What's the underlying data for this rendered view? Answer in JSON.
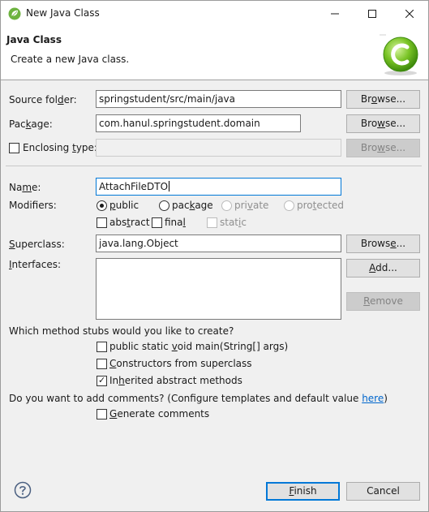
{
  "window": {
    "title": "New Java Class"
  },
  "banner": {
    "title": "Java Class",
    "message": "Create a new Java class."
  },
  "source_folder": {
    "label_pre": "Source fol",
    "label_ul": "d",
    "label_post": "er:",
    "value": "springstudent/src/main/java",
    "browse_pre": "Br",
    "browse_ul": "o",
    "browse_post": "wse..."
  },
  "package": {
    "label_pre": "Pac",
    "label_ul": "k",
    "label_post": "age:",
    "value": "com.hanul.springstudent.domain",
    "browse_pre": "Bro",
    "browse_ul": "w",
    "browse_post": "se..."
  },
  "enclosing_type": {
    "checked": false,
    "label_pre": "Enclosing ",
    "label_ul": "t",
    "label_post": "ype:",
    "value": "",
    "browse_pre": "Bro",
    "browse_ul": "w",
    "browse_post": "se..."
  },
  "name": {
    "label_pre": "Na",
    "label_ul": "m",
    "label_post": "e:",
    "value": "AttachFileDTO"
  },
  "modifiers": {
    "label": "Modifiers:",
    "public": {
      "pre": "",
      "ul": "p",
      "post": "ublic",
      "selected": true
    },
    "package": {
      "pre": "pac",
      "ul": "k",
      "post": "age",
      "selected": false
    },
    "private": {
      "pre": "pri",
      "ul": "v",
      "post": "ate",
      "selected": false
    },
    "protected": {
      "pre": "pro",
      "ul": "t",
      "post": "ected",
      "selected": false
    },
    "abstract": {
      "pre": "abs",
      "ul": "t",
      "post": "ract",
      "checked": false
    },
    "final": {
      "pre": "fina",
      "ul": "l",
      "post": "",
      "checked": false
    },
    "static": {
      "pre": "stat",
      "ul": "i",
      "post": "c",
      "checked": false
    }
  },
  "superclass": {
    "label_pre": "",
    "label_ul": "S",
    "label_post": "uperclass:",
    "value": "java.lang.Object",
    "browse_pre": "Brows",
    "browse_ul": "e",
    "browse_post": "..."
  },
  "interfaces": {
    "label_pre": "",
    "label_ul": "I",
    "label_post": "nterfaces:",
    "add_pre": "",
    "add_ul": "A",
    "add_post": "dd...",
    "remove_pre": "",
    "remove_ul": "R",
    "remove_post": "emove"
  },
  "stubs": {
    "question": "Which method stubs would you like to create?",
    "main": {
      "pre": "public static ",
      "ul": "v",
      "post": "oid main(String[] args)",
      "checked": false
    },
    "constructors": {
      "pre": "",
      "ul": "C",
      "post": "onstructors from superclass",
      "checked": false
    },
    "inherited": {
      "pre": "In",
      "ul": "h",
      "post": "erited abstract methods",
      "checked": true
    }
  },
  "comments": {
    "question": "Do you want to add comments? (Configure templates and default value ",
    "link": "here",
    "question_end": ")",
    "generate": {
      "pre": "",
      "ul": "G",
      "post": "enerate comments",
      "checked": false
    }
  },
  "footer": {
    "finish_pre": "",
    "finish_ul": "F",
    "finish_post": "inish",
    "cancel": "Cancel"
  },
  "colors": {
    "accent": "#0078d7",
    "link": "#0066cc",
    "banner_icon": "#6cc01f"
  },
  "icons": {
    "app": "spring-leaf-icon",
    "banner": "new-class-c-icon",
    "help": "help-question-icon"
  }
}
